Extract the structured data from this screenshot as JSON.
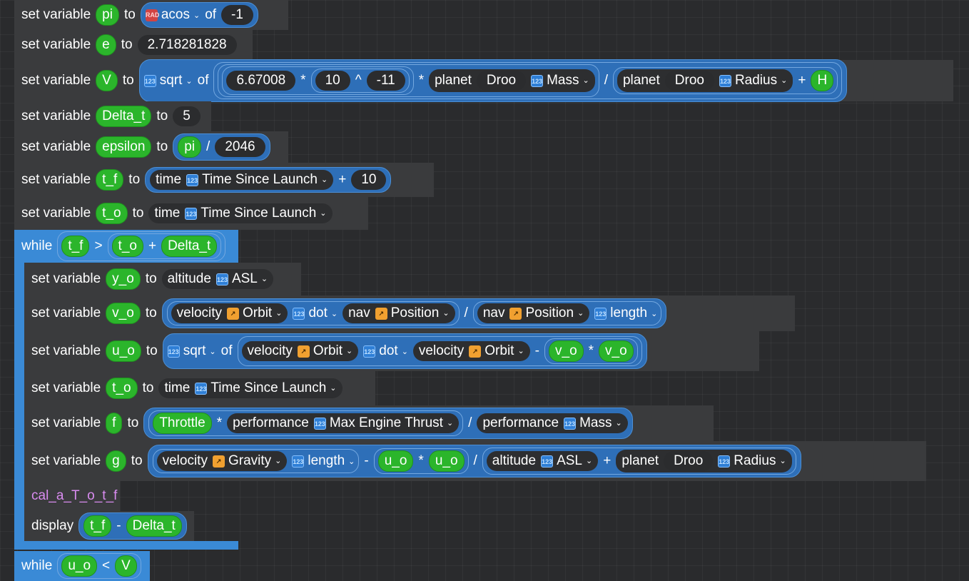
{
  "kw": {
    "set_variable": "set variable",
    "to": "to",
    "of": "of",
    "while": "while",
    "display": "display",
    "dot": "dot",
    "length": "length"
  },
  "vars": {
    "pi": "pi",
    "e": "e",
    "V": "V",
    "Delta_t": "Delta_t",
    "epsilon": "epsilon",
    "t_f": "t_f",
    "t_o": "t_o",
    "y_o": "y_o",
    "v_o": "v_o",
    "u_o": "u_o",
    "f": "f",
    "g": "g",
    "H": "H",
    "Throttle": "Throttle"
  },
  "funcs": {
    "acos": "acos",
    "sqrt": "sqrt"
  },
  "sources": {
    "time": "time",
    "planet": "planet",
    "velocity": "velocity",
    "nav": "nav",
    "altitude": "altitude",
    "performance": "performance"
  },
  "props": {
    "droo": "Droo",
    "mass": "Mass",
    "radius": "Radius",
    "time_since_launch": "Time Since Launch",
    "asl": "ASL",
    "orbit": "Orbit",
    "position": "Position",
    "gravity": "Gravity",
    "max_engine_thrust": "Max Engine Thrust"
  },
  "nums": {
    "neg1": "-1",
    "e_val": "2.718281828",
    "g_const": "6.67008",
    "ten": "10",
    "neg11": "-11",
    "five": "5",
    "n2046": "2046"
  },
  "ops": {
    "mul": "*",
    "pow": "^",
    "div": "/",
    "plus": "+",
    "minus": "-",
    "gt": ">",
    "lt": "<"
  },
  "icons": {
    "rad": "RAD",
    "num": "123"
  },
  "custom_call": "cal_a_T_o_t_f",
  "colors": {
    "variable": "#2bb52b",
    "expression": "#2e6fb8",
    "loop": "#3a8ad6",
    "block": "#3a3b3d",
    "custom": "#d98cf0"
  }
}
